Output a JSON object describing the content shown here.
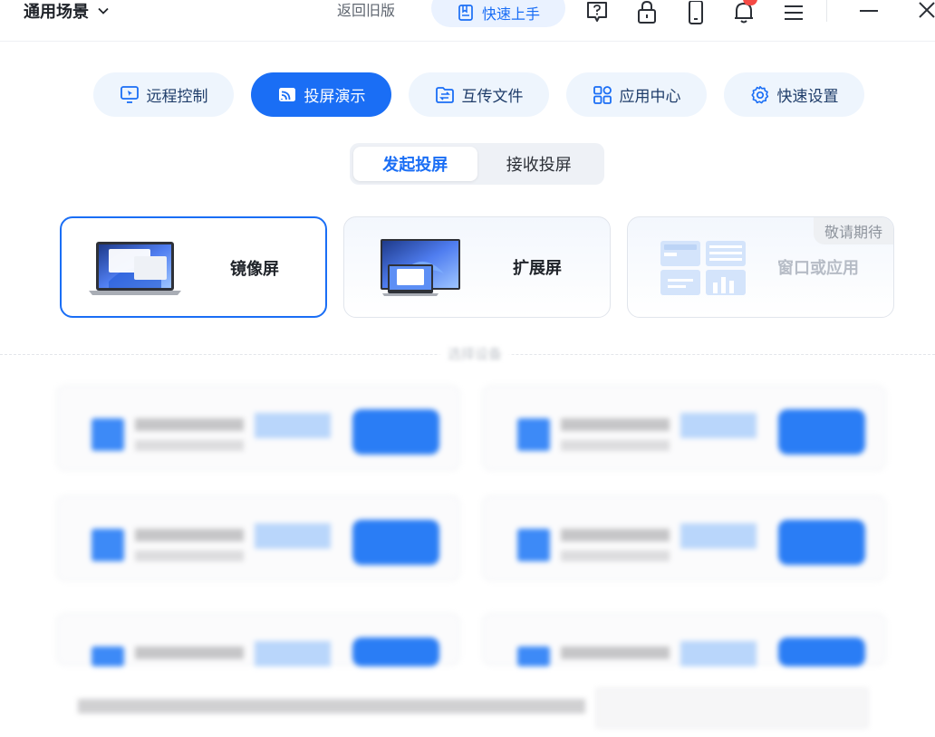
{
  "topbar": {
    "scene_label": "通用场景",
    "legacy_label": "返回旧版",
    "quickstart_label": "快速上手"
  },
  "features": [
    {
      "label": "远程控制",
      "icon": "remote-control-icon",
      "active": false
    },
    {
      "label": "投屏演示",
      "icon": "cast-icon",
      "active": true
    },
    {
      "label": "互传文件",
      "icon": "file-transfer-icon",
      "active": false
    },
    {
      "label": "应用中心",
      "icon": "app-grid-icon",
      "active": false
    },
    {
      "label": "快速设置",
      "icon": "settings-gear-icon",
      "active": false
    }
  ],
  "segment": {
    "start_label": "发起投屏",
    "receive_label": "接收投屏",
    "active": "start"
  },
  "modes": {
    "mirror_label": "镜像屏",
    "extend_label": "扩展屏",
    "window_label": "窗口或应用",
    "coming_soon_label": "敬请期待",
    "selected": "mirror"
  },
  "devices": {
    "section_title": "选择设备"
  },
  "colors": {
    "accent": "#1a6ef5",
    "tab_bg": "#eef5fd",
    "badge": "#f54a45"
  }
}
